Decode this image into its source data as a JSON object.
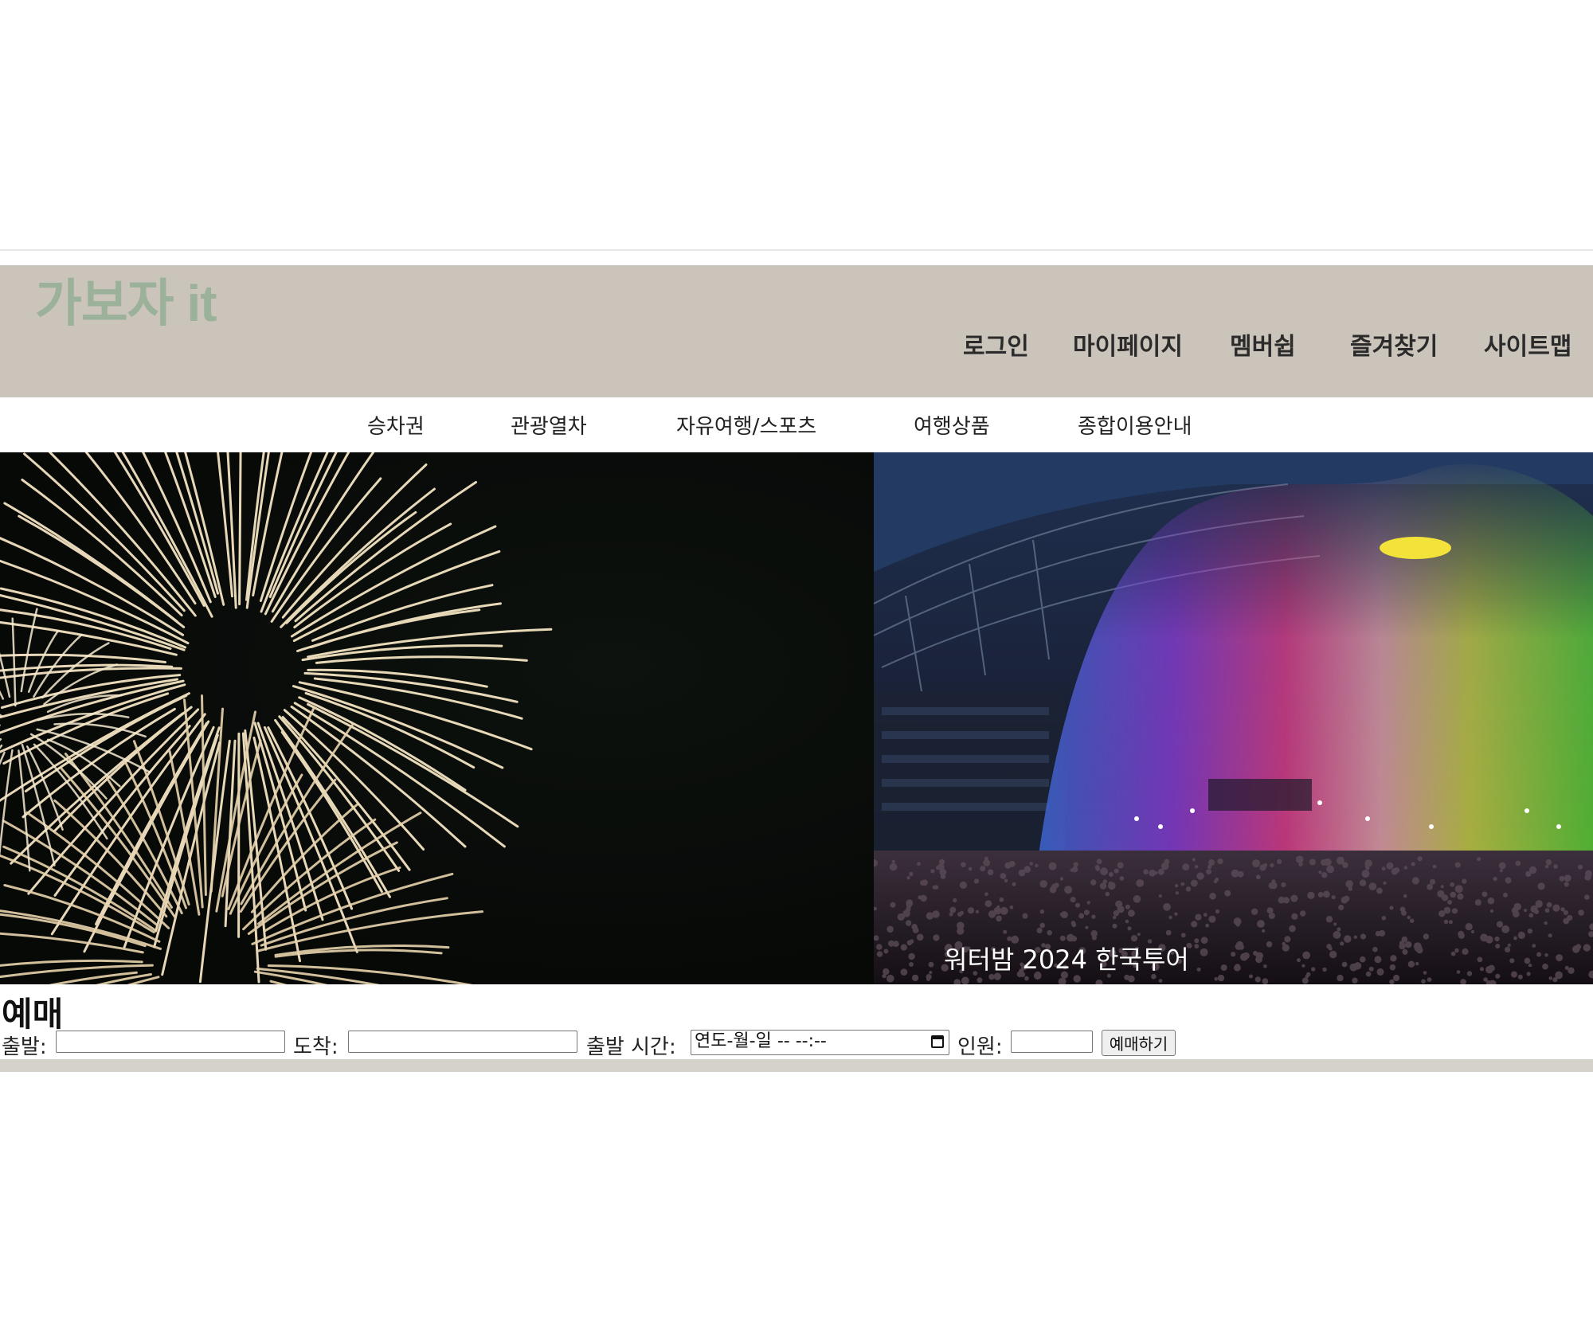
{
  "site": {
    "logo": "가보자 it"
  },
  "util_nav": {
    "items": [
      {
        "label": "로그인"
      },
      {
        "label": "마이페이지"
      },
      {
        "label": "멤버쉽"
      },
      {
        "label": "즐겨찾기"
      },
      {
        "label": "사이트맵"
      }
    ]
  },
  "main_nav": {
    "items": [
      {
        "label": "승차권"
      },
      {
        "label": "관광열차"
      },
      {
        "label": "자유여행/스포츠"
      },
      {
        "label": "여행상품"
      },
      {
        "label": "종합이용안내"
      }
    ]
  },
  "banner": {
    "left_image": "fireworks-image",
    "right_image": "concert-image",
    "caption": "워터밤 2024 한국투어"
  },
  "booking": {
    "title": "예매",
    "departure_label": "출발:",
    "departure_value": "",
    "arrival_label": "도착:",
    "arrival_value": "",
    "time_label": "출발 시간:",
    "time_placeholder": "연도-월-일 -- --:--",
    "people_label": "인원:",
    "people_value": "",
    "submit_label": "예매하기"
  },
  "colors": {
    "header_bg": "#cbc4bb",
    "logo": "#9cb19a",
    "footer_bar": "#d5d1cb"
  }
}
